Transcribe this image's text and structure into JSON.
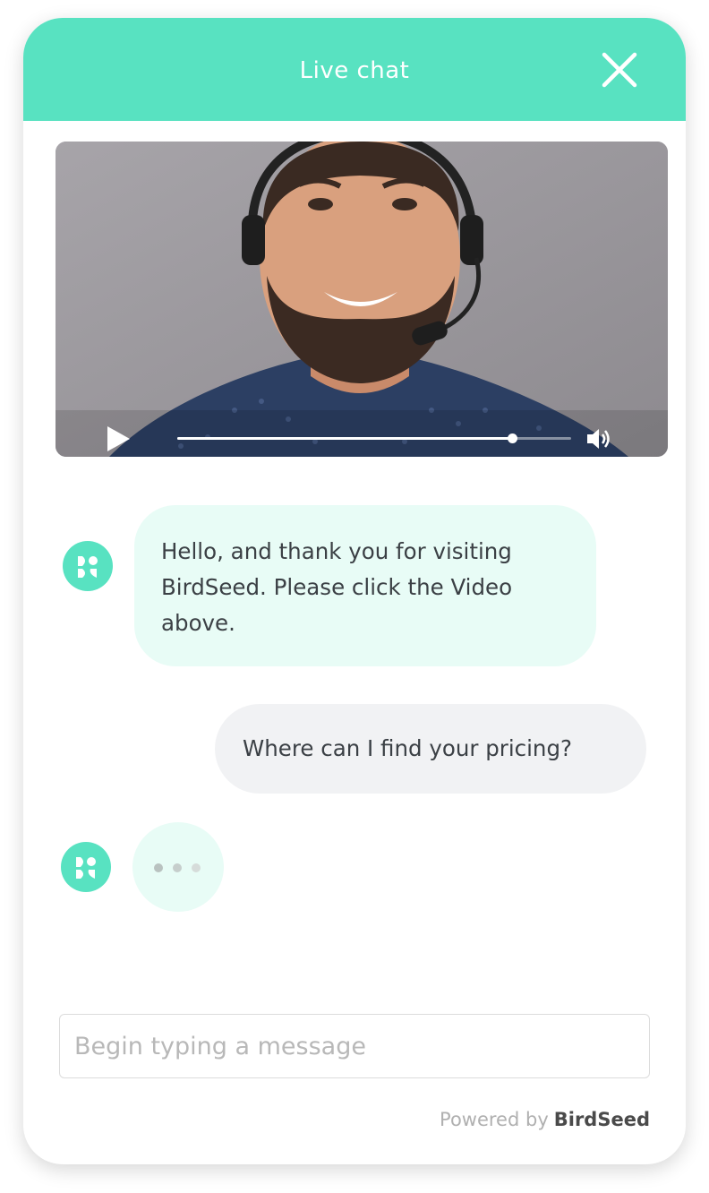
{
  "header": {
    "title": "Live chat",
    "close_icon": "close-icon",
    "background": "#58e2c1"
  },
  "video": {
    "play_icon": "play-icon",
    "volume_icon": "volume-icon",
    "progress": 0.85
  },
  "messages": [
    {
      "from": "agent",
      "avatar_icon": "birdseed-logo-icon",
      "text": "Hello, and thank you for visiting BirdSeed. Please click the Video above."
    },
    {
      "from": "visitor",
      "text": "Where can I find your pricing?"
    },
    {
      "from": "agent",
      "avatar_icon": "birdseed-logo-icon",
      "typing": true
    }
  ],
  "composer": {
    "placeholder": "Begin typing a message",
    "value": ""
  },
  "footer": {
    "powered_by": "Powered by",
    "brand": "BirdSeed"
  },
  "colors": {
    "accent": "#58e2c1",
    "agent_bubble": "#e8fcf6",
    "visitor_bubble": "#f1f2f4",
    "text": "#3b4045"
  }
}
